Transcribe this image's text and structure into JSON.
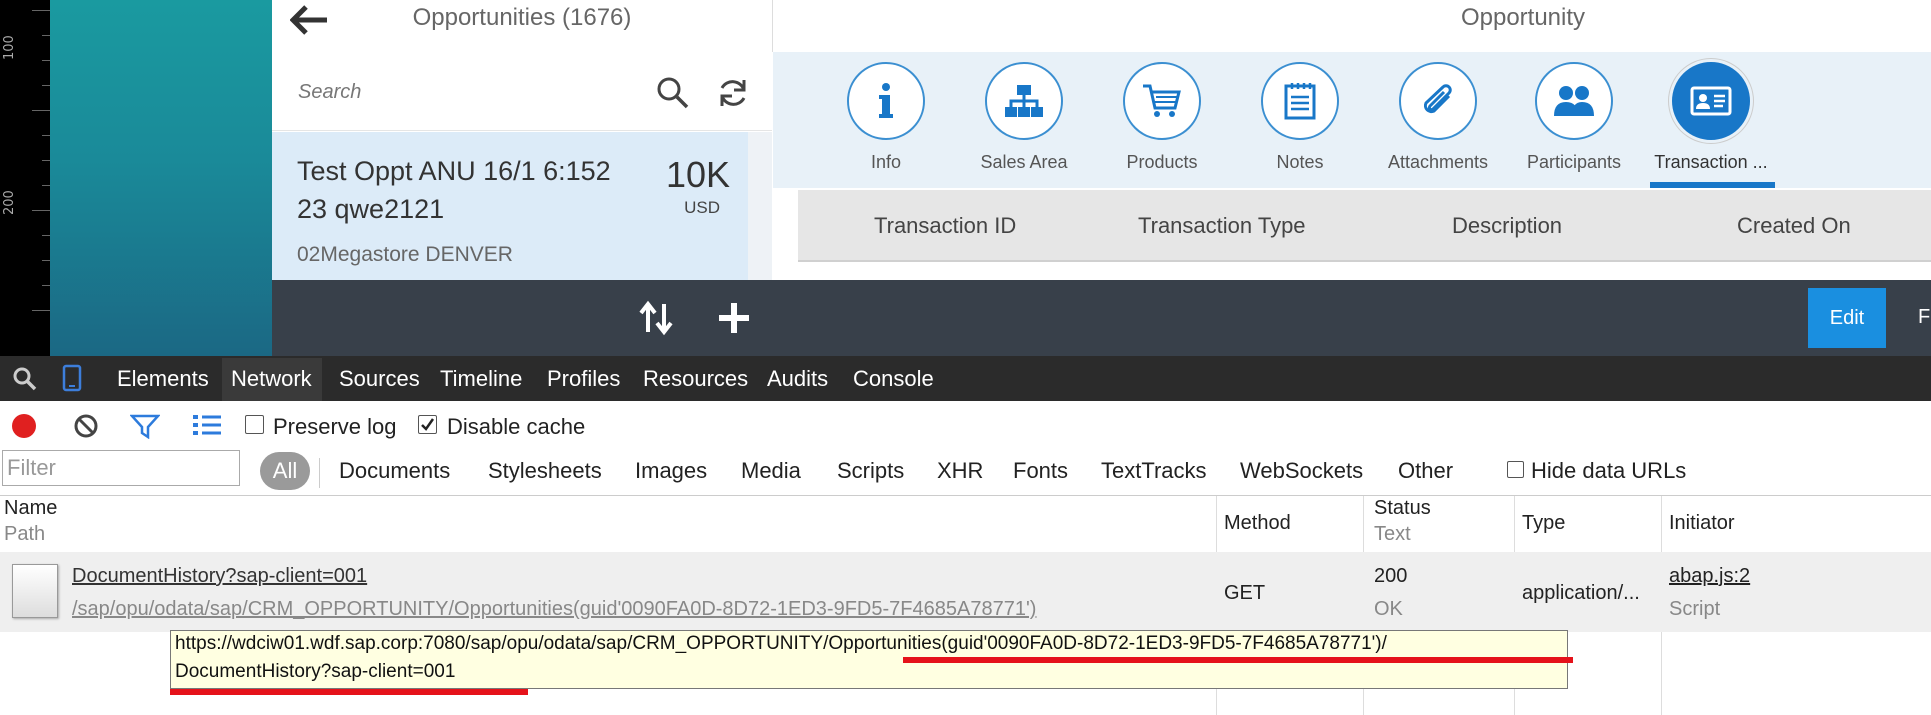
{
  "ruler": {
    "labels": [
      "100",
      "200"
    ]
  },
  "master": {
    "title": "Opportunities (1676)",
    "search_placeholder": "Search",
    "item": {
      "title_line1": "Test Oppt ANU 16/1 6:152",
      "title_line2": "23 qwe2121",
      "amount": "10K",
      "currency": "USD",
      "subtitle": "02Megastore DENVER"
    }
  },
  "detail": {
    "title": "Opportunity",
    "tabs": [
      {
        "label": "Info",
        "icon": "info-icon"
      },
      {
        "label": "Sales Area",
        "icon": "org-chart-icon"
      },
      {
        "label": "Products",
        "icon": "cart-icon"
      },
      {
        "label": "Notes",
        "icon": "notes-icon"
      },
      {
        "label": "Attachments",
        "icon": "paperclip-icon"
      },
      {
        "label": "Participants",
        "icon": "people-icon"
      },
      {
        "label": "Transaction ...",
        "icon": "id-card-icon",
        "selected": true
      }
    ],
    "table_headers": [
      "Transaction ID",
      "Transaction Type",
      "Description",
      "Created On"
    ]
  },
  "footer": {
    "edit_label": "Edit",
    "more_label": "F"
  },
  "devtools": {
    "tabs": [
      "Elements",
      "Network",
      "Sources",
      "Timeline",
      "Profiles",
      "Resources",
      "Audits",
      "Console"
    ],
    "active_tab": "Network",
    "preserve_log": "Preserve log",
    "disable_cache": "Disable cache",
    "filter_placeholder": "Filter",
    "all_label": "All",
    "filter_types": [
      "Documents",
      "Stylesheets",
      "Images",
      "Media",
      "Scripts",
      "XHR",
      "Fonts",
      "TextTracks",
      "WebSockets",
      "Other"
    ],
    "hide_data_urls": "Hide data URLs",
    "columns": {
      "name": "Name",
      "path": "Path",
      "method": "Method",
      "status": "Status",
      "text": "Text",
      "type": "Type",
      "initiator": "Initiator"
    },
    "request": {
      "name": "DocumentHistory?sap-client=001",
      "path": "/sap/opu/odata/sap/CRM_OPPORTUNITY/Opportunities(guid'0090FA0D-8D72-1ED3-9FD5-7F4685A78771')",
      "method": "GET",
      "status": "200",
      "status_text": "OK",
      "type": "application/...",
      "initiator": "abap.js:2",
      "initiator_type": "Script"
    },
    "tooltip": {
      "line1": "https://wdciw01.wdf.sap.corp:7080/sap/opu/odata/sap/CRM_OPPORTUNITY/Opportunities(guid'0090FA0D-8D72-1ED3-9FD5-7F4685A78771')/",
      "line2": "DocumentHistory?sap-client=001"
    }
  },
  "colors": {
    "accent": "#1877c8",
    "annotation_red": "#e5121a",
    "edit_button": "#1a8fe0",
    "teal": "#1a8a99"
  }
}
